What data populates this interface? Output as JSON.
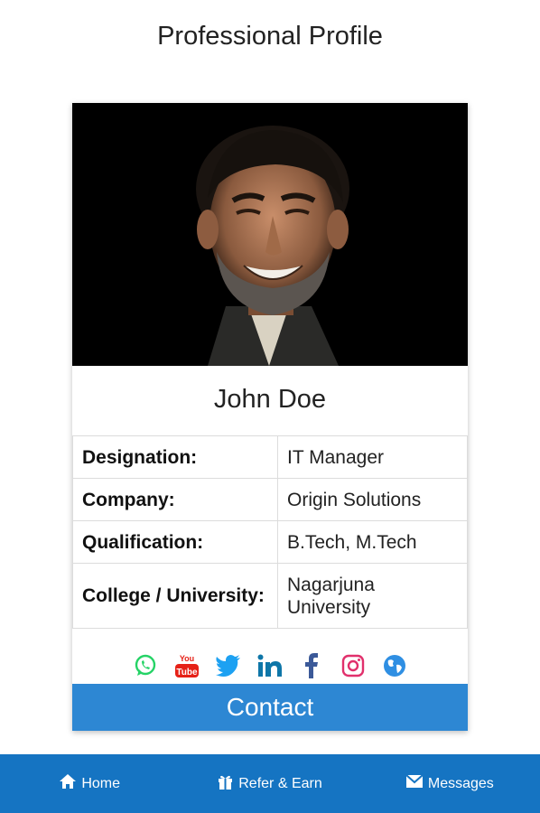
{
  "header": {
    "title": "Professional Profile"
  },
  "profile": {
    "name": "John Doe",
    "details": [
      {
        "label": "Designation:",
        "value": "IT Manager"
      },
      {
        "label": "Company:",
        "value": "Origin Solutions"
      },
      {
        "label": "Qualification:",
        "value": "B.Tech, M.Tech"
      },
      {
        "label": "College / University:",
        "value": "Nagarjuna University"
      }
    ],
    "social": [
      "whatsapp-icon",
      "youtube-icon",
      "twitter-icon",
      "linkedin-icon",
      "facebook-icon",
      "instagram-icon",
      "website-icon"
    ],
    "contact_label": "Contact"
  },
  "bottom_nav": {
    "items": [
      {
        "label": "Home",
        "icon": "home-icon"
      },
      {
        "label": "Refer & Earn",
        "icon": "gift-icon"
      },
      {
        "label": "Messages",
        "icon": "envelope-icon"
      }
    ]
  },
  "colors": {
    "accent": "#2d87d3",
    "nav_background": "#1574c2",
    "whatsapp": "#25d366",
    "youtube": "#e62117",
    "twitter": "#1da1f2",
    "linkedin": "#0e76a8",
    "facebook": "#3b5998",
    "instagram": "#e1306c",
    "website": "#2f8fe3"
  }
}
